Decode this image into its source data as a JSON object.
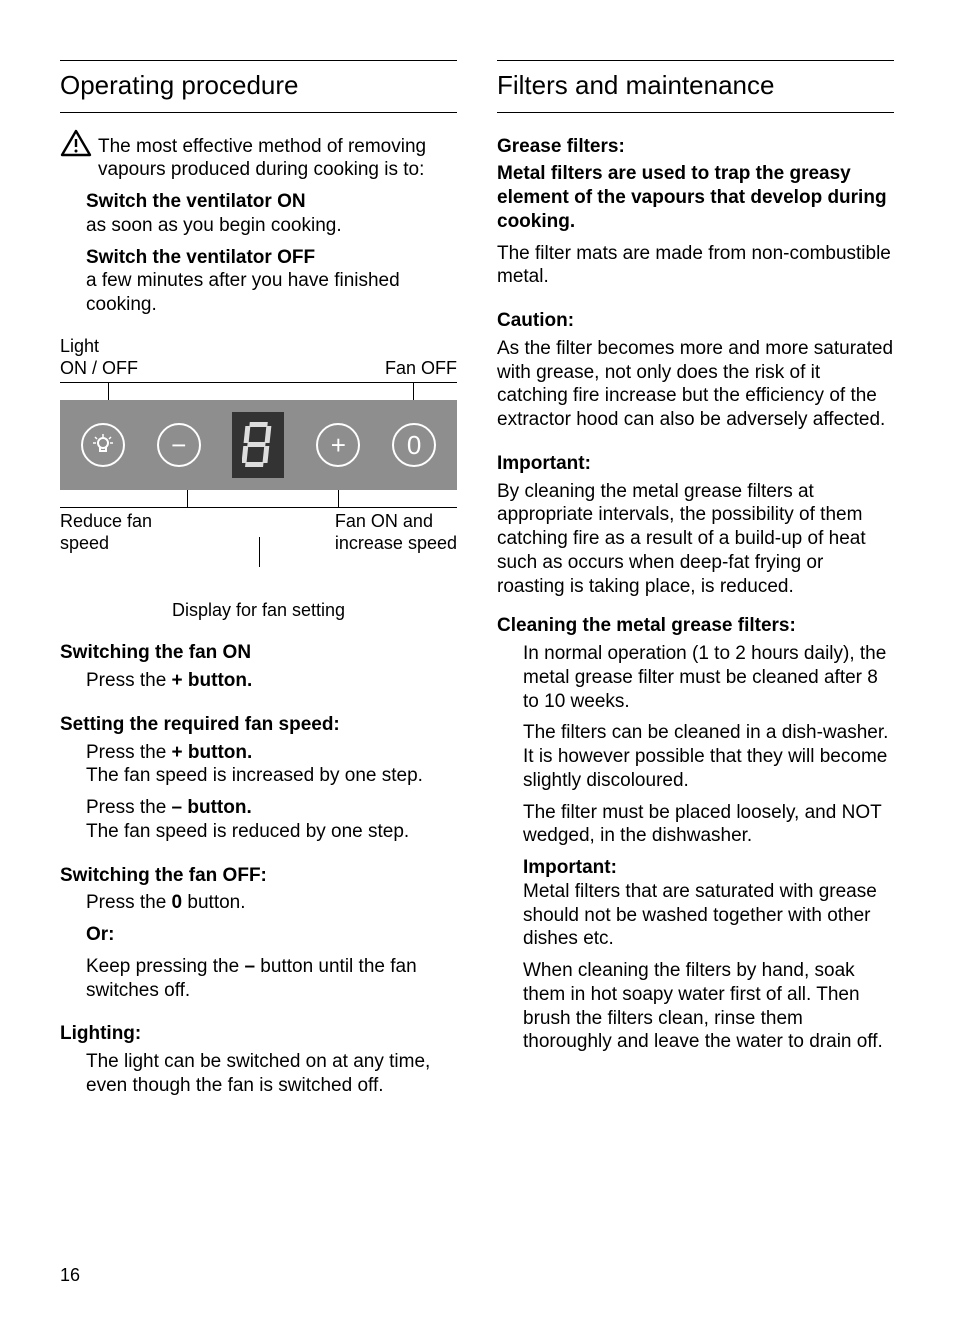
{
  "page_number": "16",
  "left": {
    "heading": "Operating procedure",
    "intro": "The most effective method of removing vapours produced during cooking is to:",
    "on_title": "Switch the ventilator ON",
    "on_desc": "as soon as you begin cooking.",
    "off_title": "Switch the ventilator OFF",
    "off_desc": "a few minutes after you have finished cooking.",
    "panel": {
      "top_left_1": "Light",
      "top_left_2": "ON / OFF",
      "top_right": "Fan OFF",
      "bottom_left_1": "Reduce fan",
      "bottom_left_2": "speed",
      "bottom_right_1": "Fan ON and",
      "bottom_right_2": "increase speed",
      "display_caption": "Display for fan setting"
    },
    "switch_on_h": "Switching the fan ON",
    "switch_on_p_pre": "Press the ",
    "switch_on_p_bold": "+ button.",
    "setting_h": "Setting the required fan speed:",
    "setting_p1_pre": "Press the ",
    "setting_p1_bold": "+ button.",
    "setting_p1_post": "The fan speed is increased by one step.",
    "setting_p2_pre": "Press the ",
    "setting_p2_bold": "– button.",
    "setting_p2_post": "The fan speed is reduced by one step.",
    "switch_off_h": "Switching the fan OFF:",
    "switch_off_p1_pre": "Press the ",
    "switch_off_p1_bold": "0",
    "switch_off_p1_post": " button.",
    "or": "Or:",
    "switch_off_p2_pre": "Keep pressing the ",
    "switch_off_p2_bold": "–",
    "switch_off_p2_post": " button until the fan switches off.",
    "lighting_h": "Lighting:",
    "lighting_p": "The light can be switched on at any time, even though the fan is switched off."
  },
  "right": {
    "heading": "Filters and maintenance",
    "grease_h": "Grease filters:",
    "grease_bold": "Metal filters are used to trap the greasy element of the vapours that develop during cooking.",
    "grease_p": "The filter mats are made from non-combustible metal.",
    "caution_h": "Caution:",
    "caution_p": "As the filter becomes more and more saturated with grease, not only does the risk of it catching fire increase but the efficiency of the extractor hood can also be adversely affected.",
    "important_h": "Important:",
    "important_p": "By cleaning the metal grease filters at appropriate intervals, the possibility of them catching fire as a result of a build-up of heat such as occurs when deep-fat frying or roasting is taking place, is reduced.",
    "cleaning_h": "Cleaning the metal grease filters:",
    "cleaning_p1": "In normal operation (1 to 2 hours daily), the metal grease filter must be cleaned after 8 to 10 weeks.",
    "cleaning_p2": "The filters can be cleaned in a dish-washer. It is however possible that they will become slightly discoloured.",
    "cleaning_p3": "The filter must be placed loosely, and NOT wedged, in the dishwasher.",
    "important2_h": "Important:",
    "important2_p": "Metal filters that are saturated with grease should not be washed together with other dishes etc.",
    "cleaning_p4": "When cleaning the filters by hand, soak them in hot soapy water first of all. Then brush the filters clean, rinse them thoroughly and leave the water to drain off."
  }
}
